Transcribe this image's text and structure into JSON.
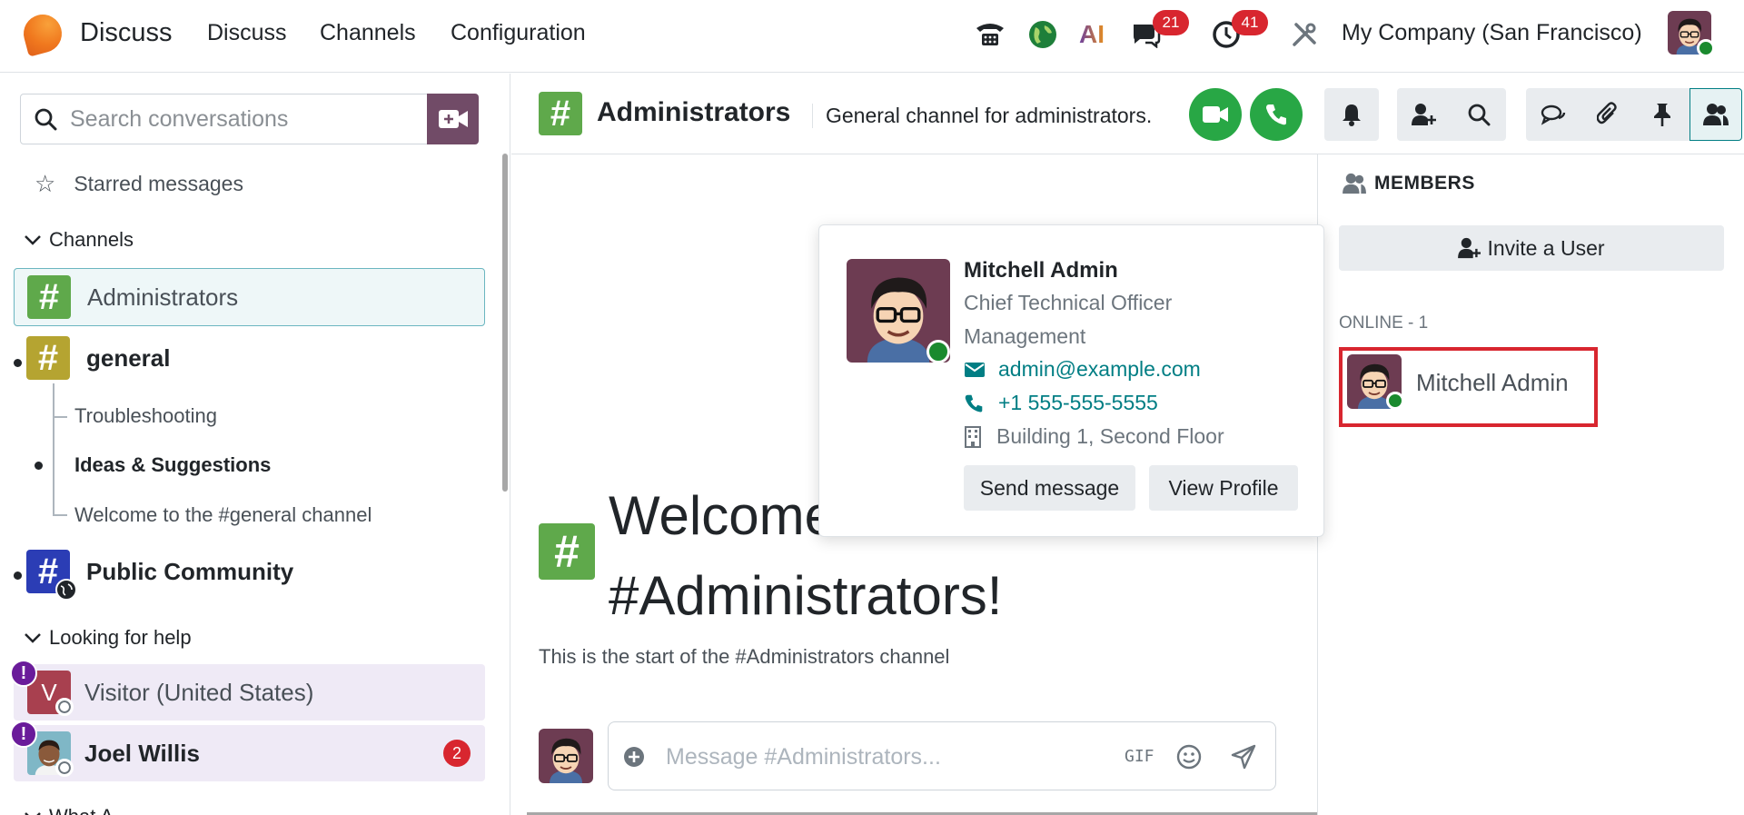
{
  "navbar": {
    "app_name": "Discuss",
    "menu": [
      "Discuss",
      "Channels",
      "Configuration"
    ],
    "messages_count": "21",
    "activities_count": "41",
    "ai_label": "AI",
    "company": "My Company (San Francisco)"
  },
  "sidebar": {
    "search_placeholder": "Search conversations",
    "starred": "Starred messages",
    "channels_header": "Channels",
    "channels": [
      {
        "name": "Administrators",
        "color": "#5fa94b"
      },
      {
        "name": "general",
        "color": "#b5a431"
      },
      {
        "name": "Public Community",
        "color": "#2b3db5"
      }
    ],
    "subchannels": [
      "Troubleshooting",
      "Ideas & Suggestions",
      "Welcome to the #general channel"
    ],
    "help_header": "Looking for help",
    "help_items": [
      {
        "name": "Visitor (United States)",
        "initial": "V"
      },
      {
        "name": "Joel Willis",
        "unread": "2"
      }
    ],
    "next_header": "What A..."
  },
  "thread": {
    "title": "Administrators",
    "description": "General channel for administrators.",
    "welcome_line1": "Welcome",
    "welcome_line2": "#Administrators!",
    "welcome_sub": "This is the start of the #Administrators channel",
    "composer_placeholder": "Message #Administrators...",
    "gif_label": "GIF"
  },
  "members": {
    "title": "MEMBERS",
    "invite_label": "Invite a User",
    "online_label": "ONLINE - 1",
    "member_name": "Mitchell Admin"
  },
  "popover": {
    "name": "Mitchell Admin",
    "job": "Chief Technical Officer",
    "department": "Management",
    "email": "admin@example.com",
    "phone": "+1 555-555-5555",
    "location": "Building 1, Second Floor",
    "send_message": "Send message",
    "view_profile": "View Profile"
  },
  "colors": {
    "brand": "#714b67",
    "call_green": "#28a745",
    "badge_red": "#d8262f",
    "link_teal": "#017e84"
  }
}
